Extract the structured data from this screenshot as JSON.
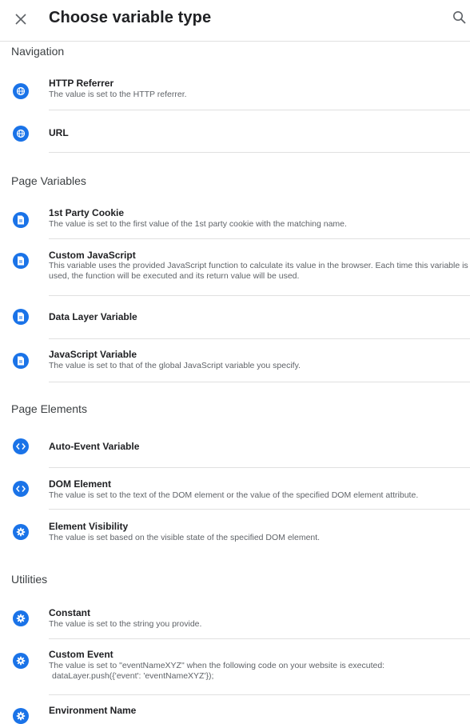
{
  "header": {
    "title": "Choose variable type",
    "close_icon": "close-icon",
    "search_icon": "search-icon"
  },
  "colors": {
    "accent": "#1a73e8",
    "divider": "#e0e0e0",
    "secondary_text": "#5f6368"
  },
  "sections": [
    {
      "title": "Navigation",
      "items": [
        {
          "name": "HTTP Referrer",
          "description": "The value is set to the HTTP referrer.",
          "icon": "globe-icon"
        },
        {
          "name": "URL",
          "description": "",
          "icon": "globe-icon"
        }
      ]
    },
    {
      "title": "Page Variables",
      "items": [
        {
          "name": "1st Party Cookie",
          "description": "The value is set to the first value of the 1st party cookie with the matching name.",
          "icon": "document-icon"
        },
        {
          "name": "Custom JavaScript",
          "description": "This variable uses the provided JavaScript function to calculate its value in the browser. Each time this variable is used, the function will be executed and its return value will be used.",
          "icon": "document-icon"
        },
        {
          "name": "Data Layer Variable",
          "description": "",
          "icon": "document-icon"
        },
        {
          "name": "JavaScript Variable",
          "description": "The value is set to that of the global JavaScript variable you specify.",
          "icon": "document-icon"
        }
      ]
    },
    {
      "title": "Page Elements",
      "items": [
        {
          "name": "Auto-Event Variable",
          "description": "",
          "icon": "code-icon"
        },
        {
          "name": "DOM Element",
          "description": "The value is set to the text of the DOM element or the value of the specified DOM element attribute.",
          "icon": "code-icon"
        },
        {
          "name": "Element Visibility",
          "description": "The value is set based on the visible state of the specified DOM element.",
          "icon": "gear-icon"
        }
      ]
    },
    {
      "title": "Utilities",
      "items": [
        {
          "name": "Constant",
          "description": "The value is set to the string you provide.",
          "icon": "gear-icon"
        },
        {
          "name": "Custom Event",
          "description": "The value is set to \"eventNameXYZ\" when the following code on your website is executed:",
          "code": "dataLayer.push({'event': 'eventNameXYZ'});",
          "icon": "gear-icon"
        },
        {
          "name": "Environment Name",
          "description": "",
          "icon": "gear-icon"
        }
      ]
    }
  ]
}
